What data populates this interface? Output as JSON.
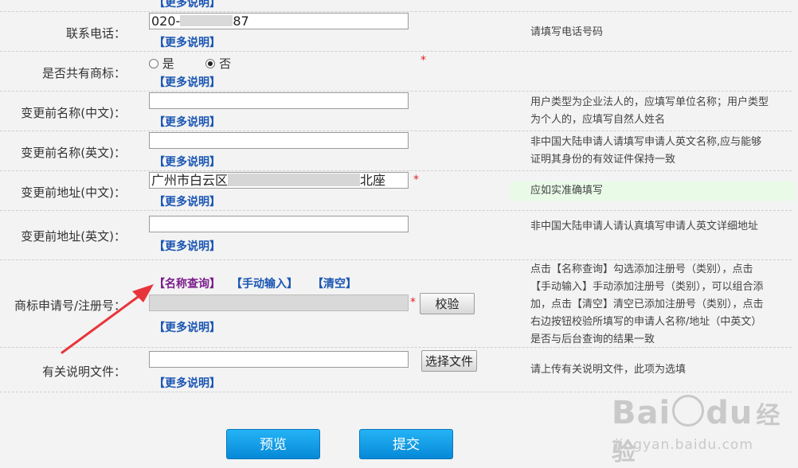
{
  "more_label": "【更多说明】",
  "phone": {
    "label": "联系电话：",
    "value_prefix": "020-",
    "value_suffix": "87",
    "hint": "请填写电话号码"
  },
  "shared": {
    "label": "是否共有商标：",
    "opt_yes": "是",
    "opt_no": "否",
    "selected": "否",
    "required": "*"
  },
  "name_cn": {
    "label": "变更前名称(中文)：",
    "value": "",
    "hint": "用户类型为企业法人的，应填写单位名称；用户类型为个人的，应填写自然人姓名"
  },
  "name_en": {
    "label": "变更前名称(英文)：",
    "value": "",
    "hint": "非中国大陆申请人请填写申请人英文名称,应与能够证明其身份的有效证件保持一致"
  },
  "addr_cn": {
    "label": "变更前地址(中文)：",
    "value_prefix": "广州市白云区",
    "value_suffix": "北座",
    "required": "*",
    "hint": "应如实准确填写"
  },
  "addr_en": {
    "label": "变更前地址(英文)：",
    "value": "",
    "hint": "非中国大陆申请人请认真填写申请人英文详细地址"
  },
  "regno": {
    "label": "商标申请号/注册号：",
    "link_query": "【名称查询】",
    "link_manual": "【手动输入】",
    "link_clear": "【清空】",
    "required": "*",
    "verify_btn": "校验",
    "hint": "点击【名称查询】勾选添加注册号（类别），点击【手动输入】手动添加注册号（类别），可以组合添加，点击【清空】清空已添加注册号（类别），点击右边按钮校验所填写的申请人名称/地址（中英文）是否与后台查询的结果一致"
  },
  "doc": {
    "label": "有关说明文件：",
    "value": "",
    "choose_btn": "选择文件",
    "hint": "请上传有关说明文件，此项为选填"
  },
  "actions": {
    "preview": "预览",
    "submit": "提交"
  },
  "colors": {
    "link_blue": "#1a56b3",
    "link_purple": "#7a1e8c",
    "required_red": "#e02020",
    "button_blue": "#0e96e6",
    "arrow_red": "#e8353b"
  },
  "watermark": {
    "brand": "Bai",
    "brand2": "du",
    "cn": "经验",
    "url": "jingyan.baidu.com"
  }
}
